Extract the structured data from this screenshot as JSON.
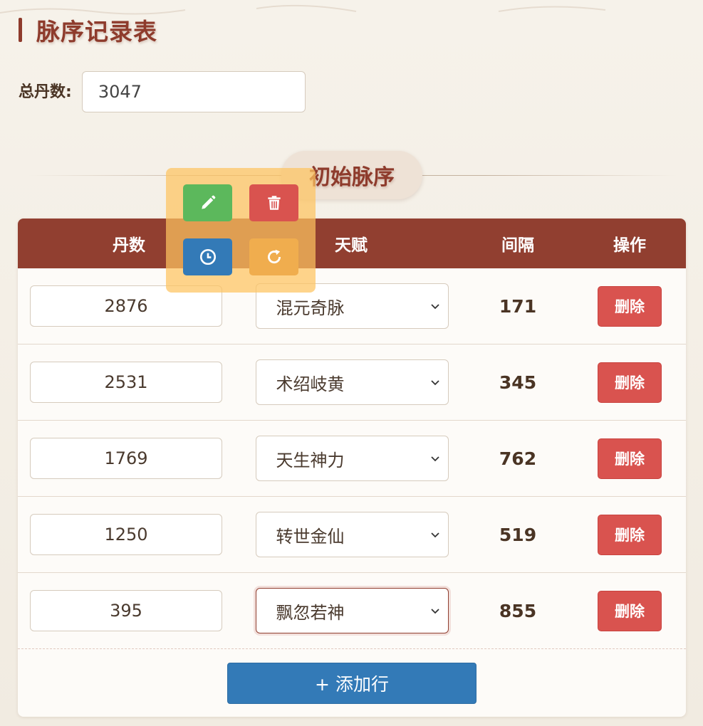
{
  "page": {
    "title": "脉序记录表"
  },
  "total": {
    "label": "总丹数:",
    "value": "3047"
  },
  "section": {
    "title": "初始脉序"
  },
  "table": {
    "headers": [
      "丹数",
      "天赋",
      "间隔",
      "操作"
    ],
    "rows": [
      {
        "dan": "2876",
        "talent": "混元奇脉",
        "interval": "171",
        "action": "删除"
      },
      {
        "dan": "2531",
        "talent": "术绍岐黄",
        "interval": "345",
        "action": "删除"
      },
      {
        "dan": "1769",
        "talent": "天生神力",
        "interval": "762",
        "action": "删除"
      },
      {
        "dan": "1250",
        "talent": "转世金仙",
        "interval": "519",
        "action": "删除"
      },
      {
        "dan": "395",
        "talent": "飘忽若神",
        "interval": "855",
        "action": "删除"
      }
    ],
    "add_label": "+ 添加行"
  },
  "toolbar": {
    "buttons": [
      {
        "icon": "pencil-icon",
        "color": "#5cb85c"
      },
      {
        "icon": "trash-icon",
        "color": "#d9534f"
      },
      {
        "icon": "clock-icon",
        "color": "#337ab7"
      },
      {
        "icon": "refresh-icon",
        "color": "#f0ad4e"
      }
    ]
  },
  "colors": {
    "accent": "#913f30",
    "primary": "#337ab7",
    "danger": "#d9534f",
    "success": "#5cb85c",
    "warning": "#f0ad4e"
  }
}
